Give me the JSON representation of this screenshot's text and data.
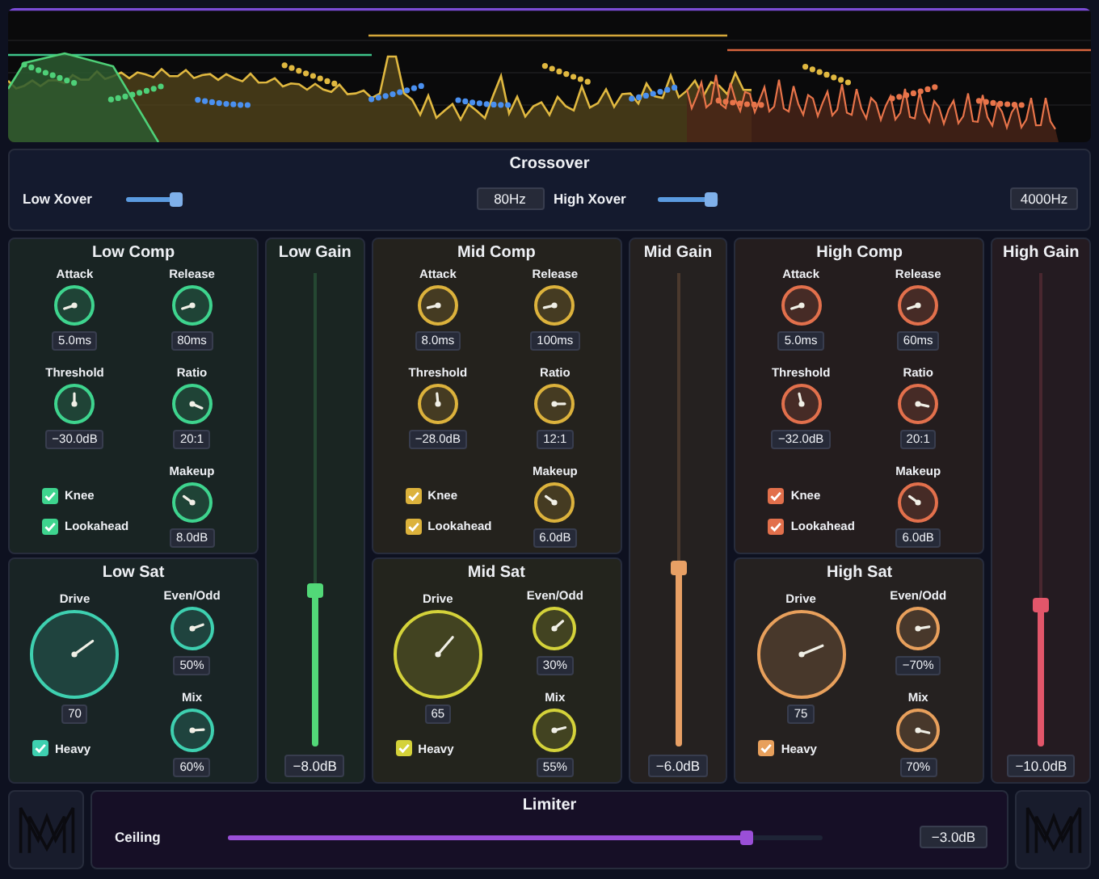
{
  "crossover": {
    "title": "Crossover",
    "controls": [
      {
        "label": "Low Xover",
        "level": 0.95,
        "value": "80Hz"
      },
      {
        "label": "High Xover",
        "level": 0.95,
        "value": "4000Hz"
      }
    ]
  },
  "bands": [
    {
      "comp": {
        "title": "Low Comp",
        "color": "#3ed48e",
        "knobs": [
          {
            "name": "Attack",
            "value": "5.0ms"
          },
          {
            "name": "Release",
            "value": "80ms"
          },
          {
            "name": "Threshold",
            "value": "−30.0dB"
          },
          {
            "name": "Ratio",
            "value": "20:1"
          },
          {
            "name": "Makeup",
            "value": "8.0dB"
          }
        ],
        "toggles": [
          {
            "label": "Knee",
            "checked": true
          },
          {
            "label": "Lookahead",
            "checked": true
          }
        ]
      },
      "sat": {
        "title": "Low Sat",
        "color": "#3ed0b0",
        "knobs": [
          {
            "name": "Drive",
            "value": "70"
          },
          {
            "name": "Even/Odd",
            "value": "50%"
          },
          {
            "name": "Mix",
            "value": "60%"
          }
        ],
        "toggle": {
          "label": "Heavy",
          "checked": true
        }
      },
      "gain": {
        "title": "Low Gain",
        "color": "#52d878",
        "level": 0.33,
        "value": "−8.0dB"
      }
    },
    {
      "comp": {
        "title": "Mid Comp",
        "color": "#dcb23c",
        "knobs": [
          {
            "name": "Attack",
            "value": "8.0ms"
          },
          {
            "name": "Release",
            "value": "100ms"
          },
          {
            "name": "Threshold",
            "value": "−28.0dB"
          },
          {
            "name": "Ratio",
            "value": "12:1"
          },
          {
            "name": "Makeup",
            "value": "6.0dB"
          }
        ],
        "toggles": [
          {
            "label": "Knee",
            "checked": true
          },
          {
            "label": "Lookahead",
            "checked": true
          }
        ]
      },
      "sat": {
        "title": "Mid Sat",
        "color": "#d4d23a",
        "knobs": [
          {
            "name": "Drive",
            "value": "65"
          },
          {
            "name": "Even/Odd",
            "value": "30%"
          },
          {
            "name": "Mix",
            "value": "55%"
          }
        ],
        "toggle": {
          "label": "Heavy",
          "checked": true
        }
      },
      "gain": {
        "title": "Mid Gain",
        "color": "#e8a065",
        "level": 0.38,
        "value": "−6.0dB"
      }
    },
    {
      "comp": {
        "title": "High Comp",
        "color": "#e2704c",
        "knobs": [
          {
            "name": "Attack",
            "value": "5.0ms"
          },
          {
            "name": "Release",
            "value": "60ms"
          },
          {
            "name": "Threshold",
            "value": "−32.0dB"
          },
          {
            "name": "Ratio",
            "value": "20:1"
          },
          {
            "name": "Makeup",
            "value": "6.0dB"
          }
        ],
        "toggles": [
          {
            "label": "Knee",
            "checked": true
          },
          {
            "label": "Lookahead",
            "checked": true
          }
        ]
      },
      "sat": {
        "title": "High Sat",
        "color": "#e8a05c",
        "knobs": [
          {
            "name": "Drive",
            "value": "75"
          },
          {
            "name": "Even/Odd",
            "value": "−70%"
          },
          {
            "name": "Mix",
            "value": "70%"
          }
        ],
        "toggle": {
          "label": "Heavy",
          "checked": true
        }
      },
      "gain": {
        "title": "High Gain",
        "color": "#e2566a",
        "level": 0.3,
        "value": "−10.0dB"
      }
    }
  ],
  "limiter": {
    "title": "Limiter",
    "label": "Ceiling",
    "level": 0.88,
    "value": "−3.0dB"
  }
}
